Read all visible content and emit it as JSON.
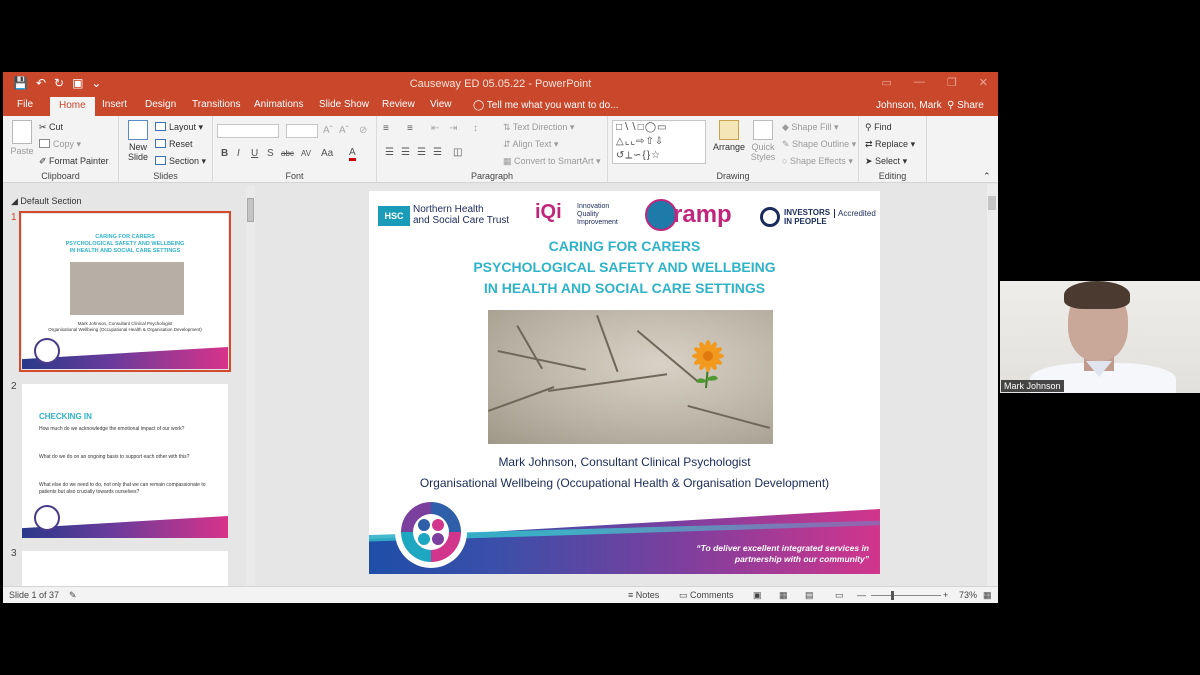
{
  "window": {
    "title": "Causeway ED 05.05.22 - PowerPoint"
  },
  "tabs": {
    "file": "File",
    "home": "Home",
    "insert": "Insert",
    "design": "Design",
    "transitions": "Transitions",
    "animations": "Animations",
    "slideshow": "Slide Show",
    "review": "Review",
    "view": "View",
    "tellme": "Tell me what you want to do...",
    "user": "Johnson, Mark",
    "share": "Share"
  },
  "ribbon": {
    "clipboard": {
      "label": "Clipboard",
      "paste": "Paste",
      "cut": "Cut",
      "copy": "Copy",
      "format_painter": "Format Painter"
    },
    "slides": {
      "label": "Slides",
      "new_slide": "New Slide",
      "layout": "Layout",
      "reset": "Reset",
      "section": "Section"
    },
    "font": {
      "label": "Font",
      "bold": "B",
      "italic": "I",
      "underline": "U",
      "shadow": "S",
      "strike": "abc",
      "spacing": "AV",
      "case": "Aa",
      "color": "A"
    },
    "paragraph": {
      "label": "Paragraph",
      "text_direction": "Text Direction",
      "align_text": "Align Text",
      "convert_smartart": "Convert to SmartArt"
    },
    "drawing": {
      "label": "Drawing",
      "arrange": "Arrange",
      "quick_styles": "Quick Styles",
      "shape_fill": "Shape Fill",
      "shape_outline": "Shape Outline",
      "shape_effects": "Shape Effects"
    },
    "editing": {
      "label": "Editing",
      "find": "Find",
      "replace": "Replace",
      "select": "Select"
    }
  },
  "thumbnails": {
    "section_name": "Default Section",
    "slides": [
      {
        "num": "1",
        "title_lines": [
          "CARING FOR CARERS",
          "PSYCHOLOGICAL SAFETY AND WELLBEING",
          "IN HEALTH AND SOCIAL CARE SETTINGS"
        ],
        "presenter": "Mark Johnson, Consultant Clinical Psychologist",
        "dept": "Organisational Wellbeing (Occupational Health & Organisation Development)"
      },
      {
        "num": "2",
        "heading": "CHECKING IN",
        "q1": "How much do we acknowledge the emotional impact of our work?",
        "q2": "What do we do on an ongoing basis to support each other with this?",
        "q3": "What else do we need to do, not only that we can remain compassionate to patients but also crucially towards ourselves?"
      },
      {
        "num": "3"
      }
    ]
  },
  "slide": {
    "org1": "Northern Health",
    "org2": "and Social Care Trust",
    "hsc": "HSC",
    "iqi": "iQi",
    "iqi_1": "Innovation",
    "iqi_2": "Quality",
    "iqi_3": "Improvement",
    "ramp": "ramp",
    "iip_1": "INVESTORS",
    "iip_2": "IN PEOPLE",
    "accredited": "Accredited",
    "title_1": "CARING FOR CARERS",
    "title_2": "PSYCHOLOGICAL SAFETY AND WELLBEING",
    "title_3": "IN HEALTH AND SOCIAL CARE SETTINGS",
    "presenter": "Mark Johnson, Consultant Clinical Psychologist",
    "dept": "Organisational Wellbeing (Occupational Health & Organisation Development)",
    "tagline_1": "“To deliver excellent integrated services in",
    "tagline_2": "partnership with our community”"
  },
  "status": {
    "slide_of": "Slide 1 of 37",
    "notes": "Notes",
    "comments": "Comments",
    "zoom": "73%"
  },
  "webcam": {
    "name": "Mark Johnson"
  }
}
